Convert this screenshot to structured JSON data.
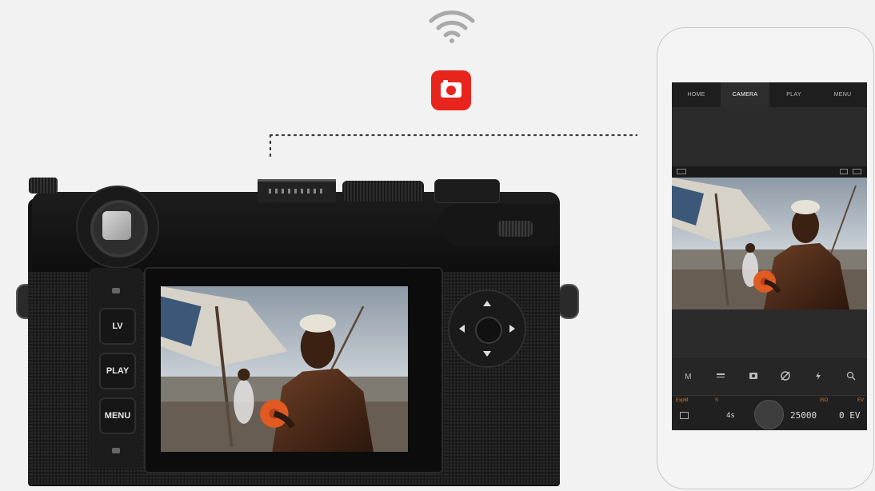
{
  "icons": {
    "wifi": "wifi-icon",
    "app": "leica-fotos-app-icon"
  },
  "colors": {
    "app_red": "#e8251d",
    "background": "#f2f2f2",
    "exposure_label": "#e07a2a"
  },
  "camera": {
    "buttons": {
      "lv": "LV",
      "play": "PLAY",
      "menu": "MENU"
    }
  },
  "phone_app": {
    "tabs": [
      "HOME",
      "CAMERA",
      "PLAY",
      "MENU"
    ],
    "active_tab": "CAMERA",
    "mode_bar": {
      "mode": "M",
      "icons": [
        "white-balance-icon",
        "metering-icon",
        "focus-icon",
        "flash-off-icon",
        "zoom-icon"
      ]
    },
    "exposure": {
      "exp_mode_label": "ExpM",
      "shutter_label": "S",
      "shutter_value": "4s",
      "iso_label": "ISO",
      "iso_value": "25000",
      "ev_label": "EV",
      "ev_value": "0 EV"
    }
  }
}
